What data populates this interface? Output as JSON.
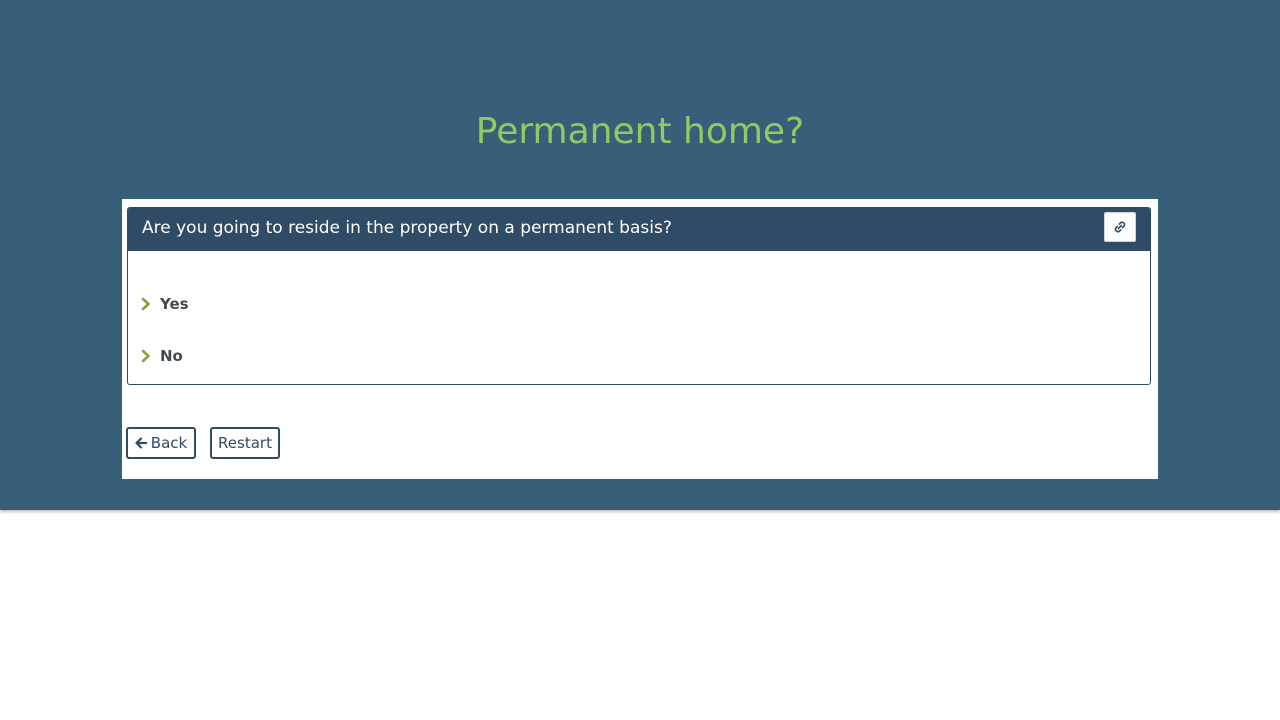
{
  "page": {
    "title": "Permanent home?"
  },
  "question": {
    "text": "Are you going to reside in the property on a permanent basis?",
    "options": [
      {
        "label": "Yes",
        "icon": "chevron-right-icon"
      },
      {
        "label": "No",
        "icon": "chevron-right-icon"
      }
    ],
    "link_icon": "link-icon"
  },
  "navigation": {
    "back_label": "Back",
    "back_icon": "arrow-left-icon",
    "restart_label": "Restart"
  },
  "colors": {
    "background": "#385f7a",
    "header": "#2f4b66",
    "title": "#8dcc5e",
    "chevron": "#8aa03a"
  }
}
